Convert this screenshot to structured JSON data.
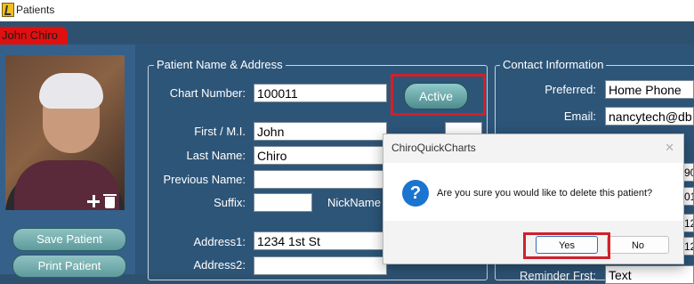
{
  "window": {
    "title": "Patients"
  },
  "tab": {
    "patient_name": "John Chiro"
  },
  "photo_tools": {
    "add_icon": "plus-icon",
    "delete_icon": "trash-icon"
  },
  "actions": {
    "save": "Save Patient",
    "print": "Print Patient"
  },
  "name_address": {
    "legend": "Patient Name & Address",
    "chart_number_label": "Chart Number:",
    "chart_number": "100011",
    "status_button": "Active",
    "first_label": "First / M.I.",
    "first": "John",
    "last_label": "Last Name:",
    "last": "Chiro",
    "previous_label": "Previous Name:",
    "previous": "",
    "suffix_label": "Suffix:",
    "suffix": "",
    "nickname_label": "NickName",
    "address1_label": "Address1:",
    "address1": "1234 1st St",
    "address2_label": "Address2:",
    "address2": ""
  },
  "contact": {
    "legend": "Contact Information",
    "preferred_label": "Preferred:",
    "preferred": "Home Phone",
    "email_label": "Email:",
    "email": "nancytech@db",
    "partial_values": [
      "90",
      "01",
      "12",
      "12"
    ],
    "reminder_label": "Reminder Frst:",
    "reminder": "Text"
  },
  "dialog": {
    "title": "ChiroQuickCharts",
    "message": "Are you sure you would like to delete this patient?",
    "yes": "Yes",
    "no": "No",
    "close_icon": "close-icon",
    "question_icon": "question-icon"
  },
  "colors": {
    "highlight": "#d0202a",
    "tab": "#e01010",
    "background": "#2d5578"
  }
}
